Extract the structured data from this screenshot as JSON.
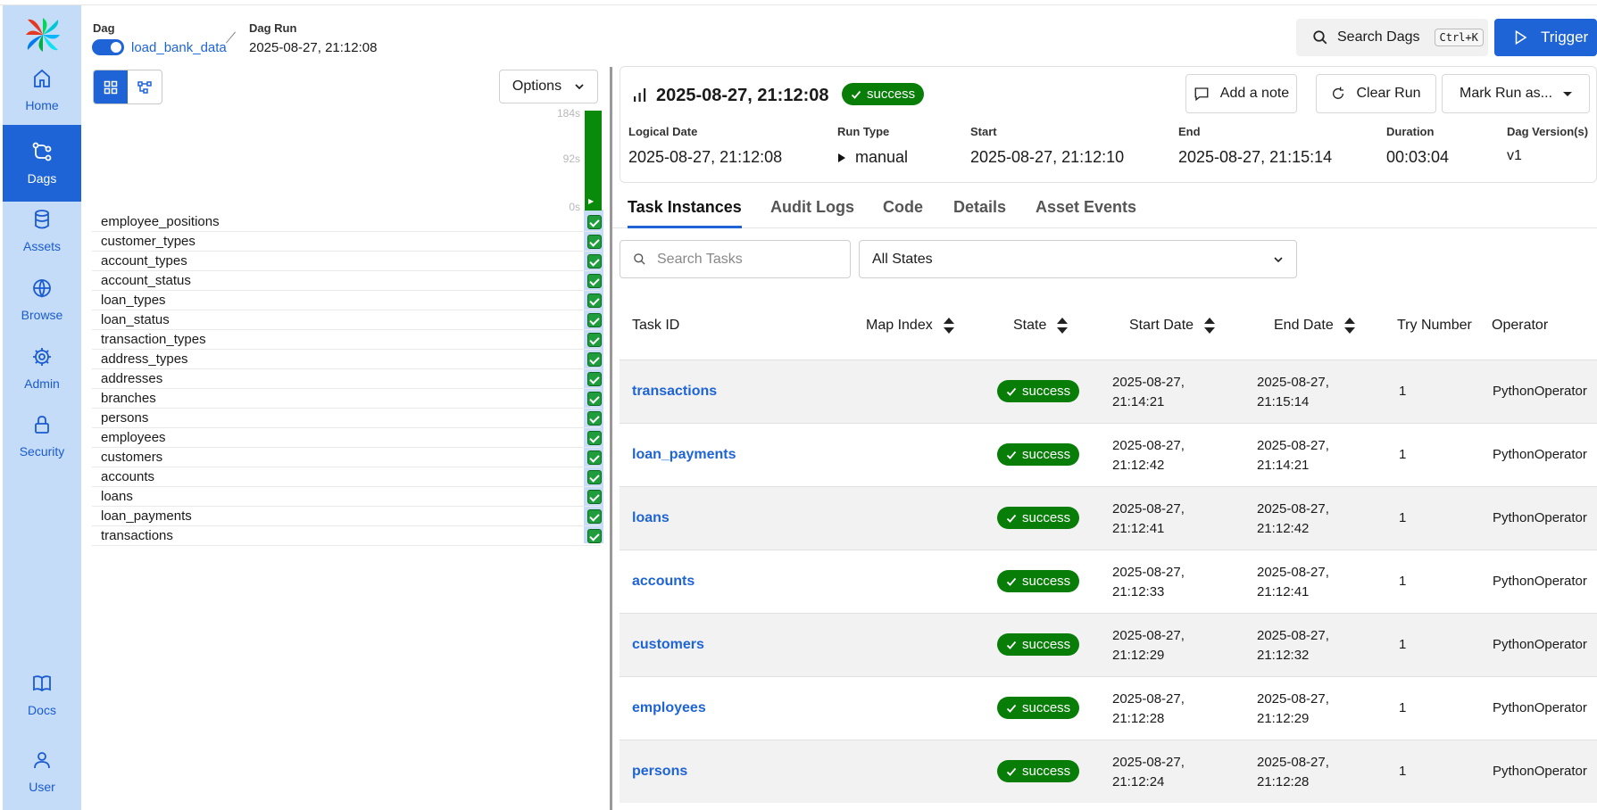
{
  "sidebar": {
    "items": [
      {
        "label": "Home",
        "icon": "home-icon"
      },
      {
        "label": "Dags",
        "icon": "dags-icon",
        "active": true
      },
      {
        "label": "Assets",
        "icon": "database-icon"
      },
      {
        "label": "Browse",
        "icon": "globe-icon"
      },
      {
        "label": "Admin",
        "icon": "gear-icon"
      },
      {
        "label": "Security",
        "icon": "lock-icon"
      },
      {
        "label": "Docs",
        "icon": "book-icon"
      },
      {
        "label": "User",
        "icon": "user-icon"
      }
    ]
  },
  "header": {
    "dag_label": "Dag",
    "dag_name": "load_bank_data",
    "dag_run_label": "Dag Run",
    "dag_run_value": "2025-08-27, 21:12:08",
    "search_label": "Search Dags",
    "search_shortcut": "Ctrl+K",
    "trigger_label": "Trigger"
  },
  "left_pane": {
    "options_label": "Options",
    "axis_ticks": [
      "184s",
      "92s",
      "0s"
    ],
    "tasks": [
      "employee_positions",
      "customer_types",
      "account_types",
      "account_status",
      "loan_types",
      "loan_status",
      "transaction_types",
      "address_types",
      "addresses",
      "branches",
      "persons",
      "employees",
      "customers",
      "accounts",
      "loans",
      "loan_payments",
      "transactions"
    ]
  },
  "run": {
    "title": "2025-08-27, 21:12:08",
    "status": "success",
    "actions": {
      "add_note": "Add a note",
      "clear_run": "Clear Run",
      "mark_run": "Mark Run as..."
    },
    "meta": {
      "logical_date_label": "Logical Date",
      "logical_date": "2025-08-27, 21:12:08",
      "run_type_label": "Run Type",
      "run_type": "manual",
      "start_label": "Start",
      "start": "2025-08-27, 21:12:10",
      "end_label": "End",
      "end": "2025-08-27, 21:15:14",
      "duration_label": "Duration",
      "duration": "00:03:04",
      "version_label": "Dag Version(s)",
      "version": "v1"
    }
  },
  "tabs": [
    "Task Instances",
    "Audit Logs",
    "Code",
    "Details",
    "Asset Events"
  ],
  "filters": {
    "search_placeholder": "Search Tasks",
    "state_value": "All States"
  },
  "table": {
    "headers": {
      "task_id": "Task ID",
      "map_index": "Map Index",
      "state": "State",
      "start_date": "Start Date",
      "end_date": "End Date",
      "try_number": "Try Number",
      "operator": "Operator"
    },
    "rows": [
      {
        "task_id": "transactions",
        "state": "success",
        "start_date": "2025-08-27,",
        "start_time": "21:14:21",
        "end_date": "2025-08-27,",
        "end_time": "21:15:14",
        "try": "1",
        "operator": "PythonOperator"
      },
      {
        "task_id": "loan_payments",
        "state": "success",
        "start_date": "2025-08-27,",
        "start_time": "21:12:42",
        "end_date": "2025-08-27,",
        "end_time": "21:14:21",
        "try": "1",
        "operator": "PythonOperator"
      },
      {
        "task_id": "loans",
        "state": "success",
        "start_date": "2025-08-27,",
        "start_time": "21:12:41",
        "end_date": "2025-08-27,",
        "end_time": "21:12:42",
        "try": "1",
        "operator": "PythonOperator"
      },
      {
        "task_id": "accounts",
        "state": "success",
        "start_date": "2025-08-27,",
        "start_time": "21:12:33",
        "end_date": "2025-08-27,",
        "end_time": "21:12:41",
        "try": "1",
        "operator": "PythonOperator"
      },
      {
        "task_id": "customers",
        "state": "success",
        "start_date": "2025-08-27,",
        "start_time": "21:12:29",
        "end_date": "2025-08-27,",
        "end_time": "21:12:32",
        "try": "1",
        "operator": "PythonOperator"
      },
      {
        "task_id": "employees",
        "state": "success",
        "start_date": "2025-08-27,",
        "start_time": "21:12:28",
        "end_date": "2025-08-27,",
        "end_time": "21:12:29",
        "try": "1",
        "operator": "PythonOperator"
      },
      {
        "task_id": "persons",
        "state": "success",
        "start_date": "2025-08-27,",
        "start_time": "21:12:24",
        "end_date": "2025-08-27,",
        "end_time": "21:12:28",
        "try": "1",
        "operator": "PythonOperator"
      }
    ]
  },
  "colors": {
    "accent": "#1e64d6",
    "sidebar_bg": "#c5dcf8",
    "success": "#087d08"
  }
}
